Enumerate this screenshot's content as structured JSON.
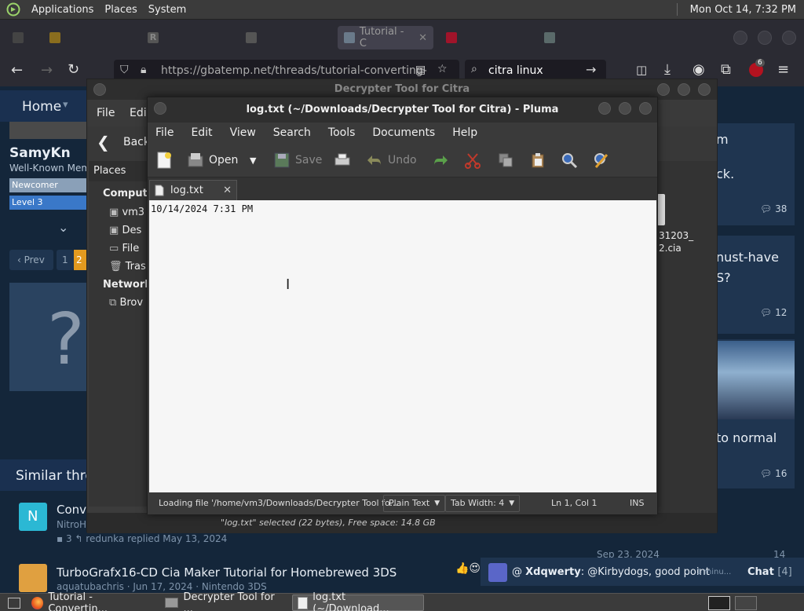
{
  "top_panel": {
    "menu": [
      "Applications",
      "Places",
      "System"
    ],
    "clock": "Mon Oct 14,  7:32 PM"
  },
  "browser": {
    "tabs": [
      {
        "label": "",
        "active": false
      },
      {
        "label": "",
        "active": false
      },
      {
        "label": "",
        "active": false
      },
      {
        "label": "Tutorial - C",
        "active": true
      },
      {
        "label": "",
        "active": false
      },
      {
        "label": "",
        "active": false
      }
    ],
    "url_host": "https://gbatemp.net",
    "url_path": "/threads/tutorial-converting-",
    "search": "citra linux",
    "badge_count": "6"
  },
  "webpage": {
    "nav_home": "Home",
    "nav_right": "st",
    "user_name": "SamyKn",
    "user_title": "Well-Known Mem",
    "rank1": "Newcomer",
    "rank2": "Level 3",
    "pagination_prev": "‹ Prev",
    "pagination": [
      "1",
      "2"
    ],
    "similar_heading": "Similar thre",
    "thread1_title": "Conve",
    "thread1_author": "NitroH",
    "thread1_meta_count": "3",
    "thread1_replier": "redunka",
    "thread1_replied": "replied May 13, 2024",
    "thread2_title": "TurboGrafx16-CD Cia Maker Tutorial for Homebrewed 3DS",
    "thread2_meta": "aquatubachris · Jun 17, 2024 · Nintendo 3DS",
    "right_snippets": [
      "m",
      "ck.",
      "nust-have",
      "S?",
      "to normal"
    ],
    "right_counts": [
      "38",
      "12",
      "16"
    ],
    "right_date": "Sep 23, 2024",
    "right_last_count": "14",
    "chat_user": "Xdqwerty",
    "chat_text": ": @Kirbydogs, good point",
    "chat_time": "1 minu...",
    "chat_label": "Chat",
    "chat_count": "[4]"
  },
  "file_manager": {
    "title": "Decrypter Tool for Citra",
    "menu": [
      "File",
      "Edit"
    ],
    "back_label": "Back",
    "places_label": "Places",
    "computer_heading": "Compute",
    "places": [
      "vm3",
      "Des",
      "File",
      "Tras"
    ],
    "network_heading": "Network",
    "network_items": [
      "Brov"
    ],
    "file_item_line1": "31203_",
    "file_item_line2": "2.cia",
    "status": "\"log.txt\" selected (22 bytes), Free space: 14.8 GB"
  },
  "editor": {
    "title": "log.txt (~/Downloads/Decrypter Tool for Citra) - Pluma",
    "menu": [
      "File",
      "Edit",
      "View",
      "Search",
      "Tools",
      "Documents",
      "Help"
    ],
    "toolbar": {
      "open": "Open",
      "save": "Save",
      "undo": "Undo"
    },
    "tab_label": "log.txt",
    "content": "10/14/2024 7:31 PM",
    "status_loading": "Loading file '/home/vm3/Downloads/Decrypter Tool fo...",
    "status_lang": "Plain Text",
    "status_tabwidth": "Tab Width:  4",
    "status_position": "Ln 1, Col 1",
    "status_mode": "INS"
  },
  "taskbar": {
    "items": [
      {
        "label": "Tutorial - Convertin...",
        "active": false
      },
      {
        "label": "Decrypter Tool for ...",
        "active": false
      },
      {
        "label": "log.txt (~/Download...",
        "active": true
      }
    ]
  }
}
